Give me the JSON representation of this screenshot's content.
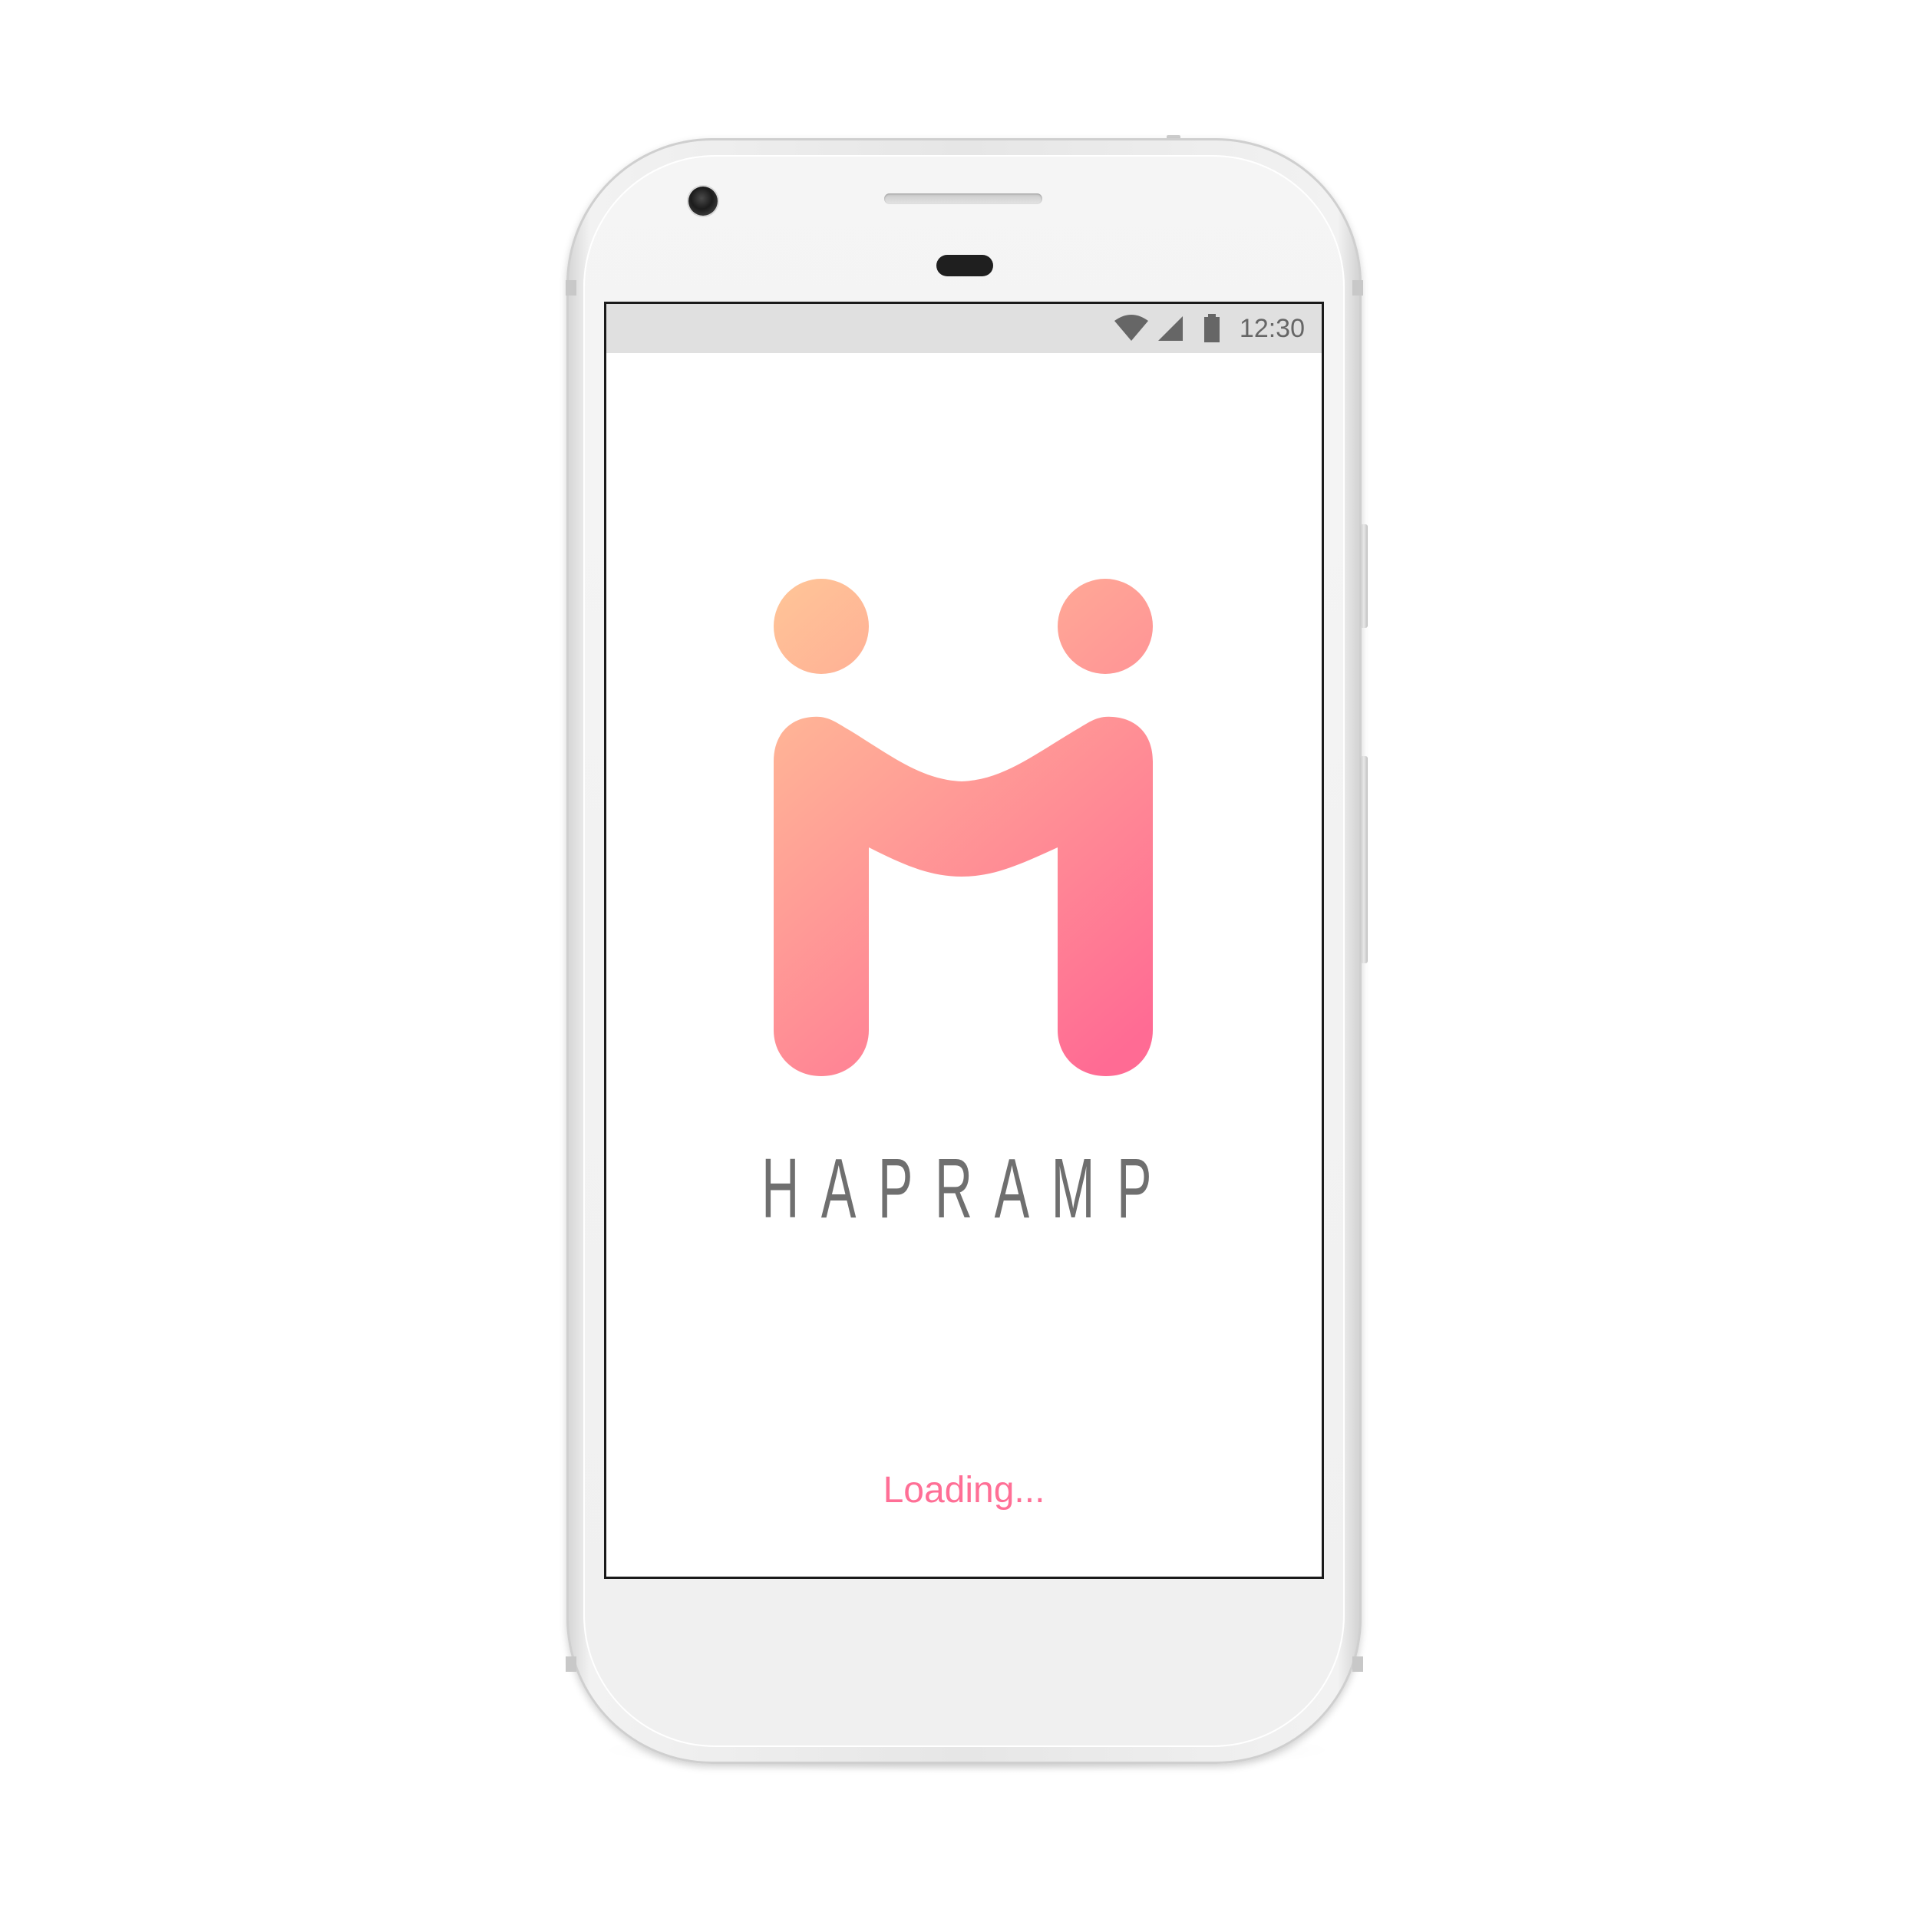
{
  "status_bar": {
    "time": "12:30",
    "icons": [
      "wifi-icon",
      "cellular-signal-icon",
      "battery-icon"
    ]
  },
  "splash": {
    "brand_name": "HAPRAMP",
    "loading_text": "Loading...",
    "logo": "hapramp-logo"
  },
  "colors": {
    "brand_gradient_start": "#ffc597",
    "brand_gradient_end": "#ff6b94",
    "loading_text": "#ff6f96",
    "brand_name": "#6f6f6f",
    "status_bar_bg": "#e0e0e0"
  }
}
